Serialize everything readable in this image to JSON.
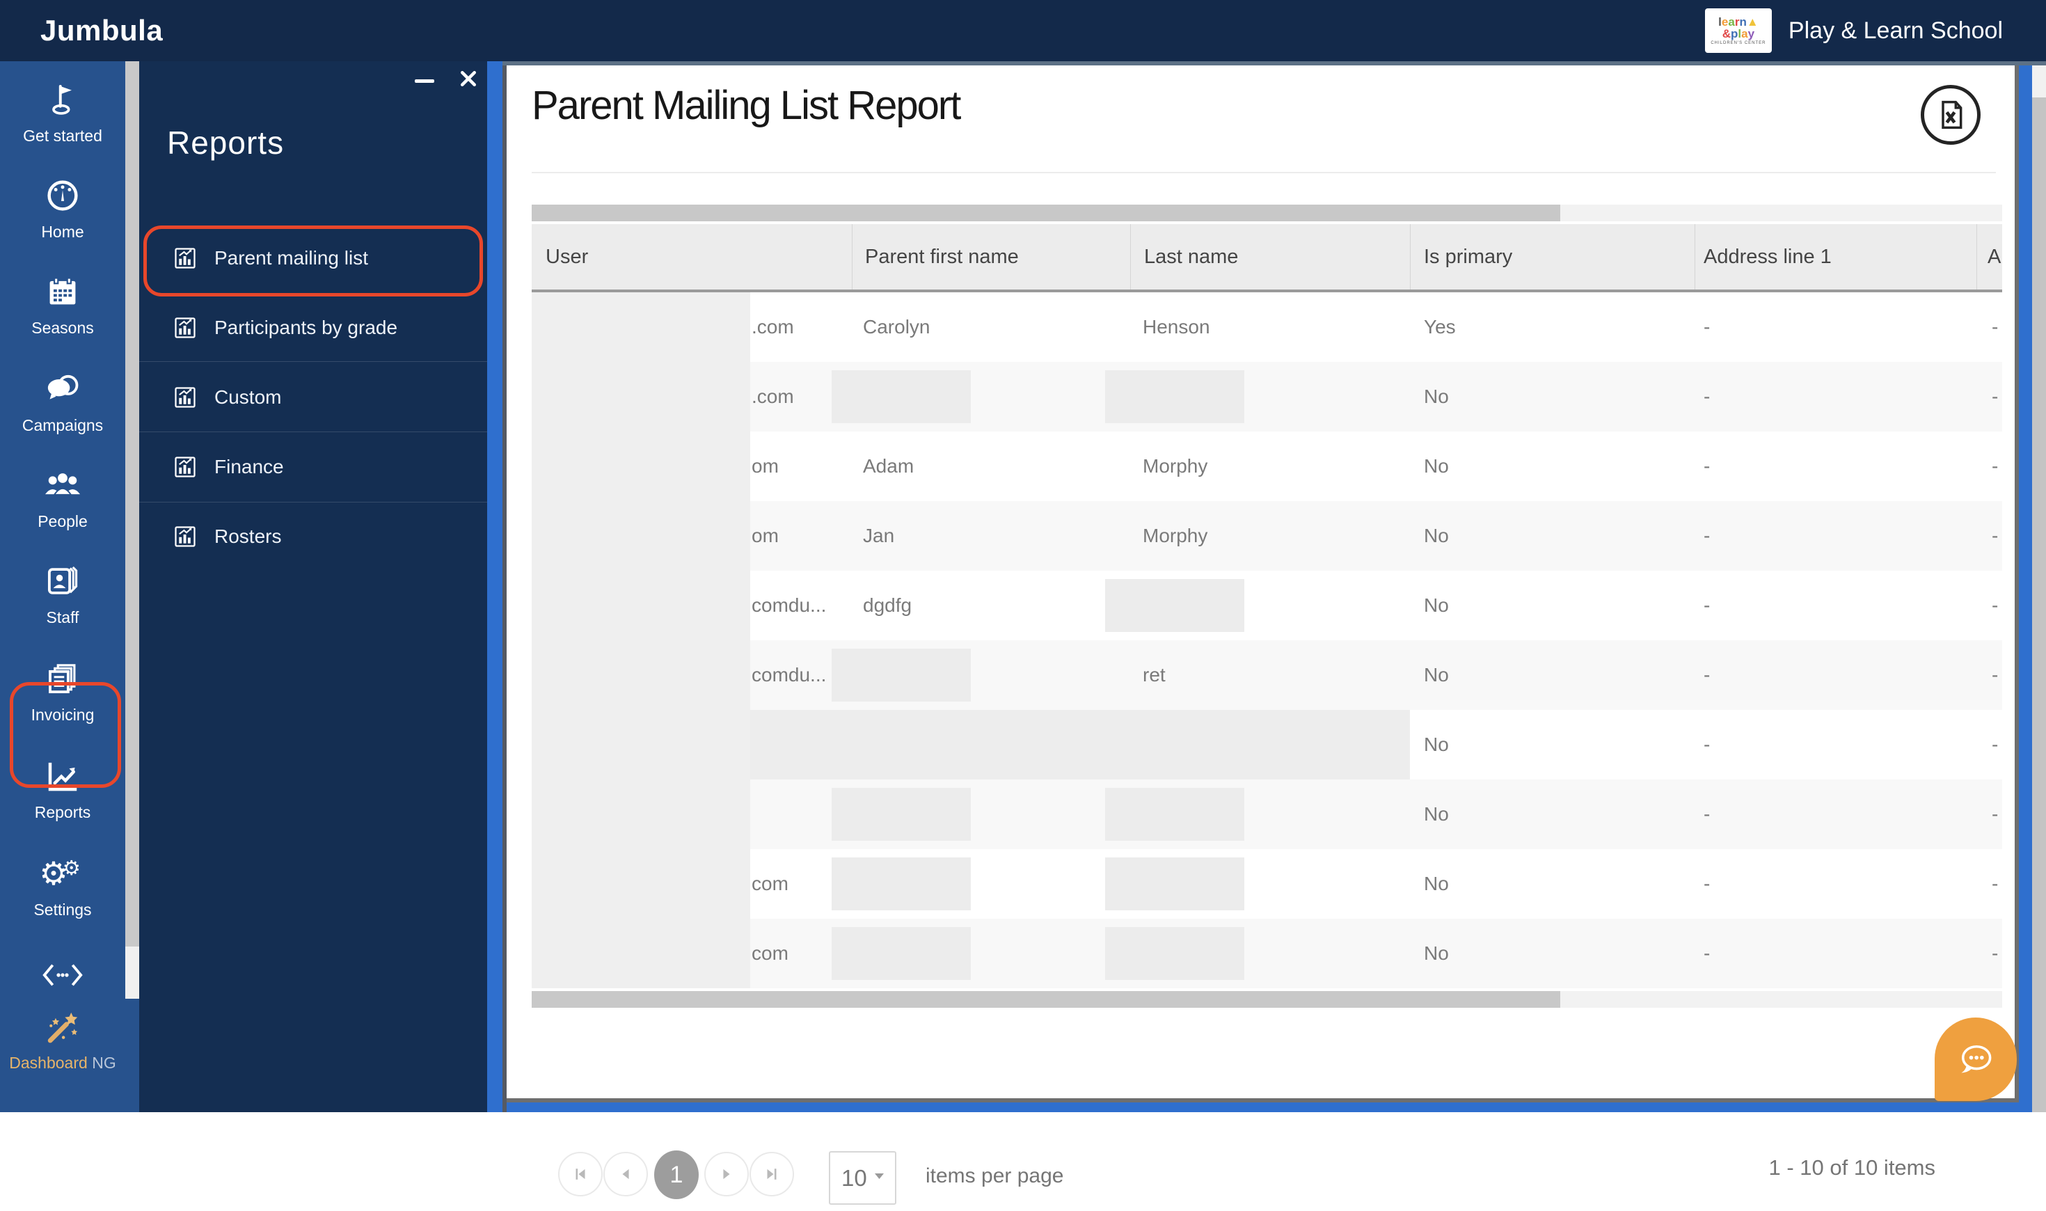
{
  "colors": {
    "topbar_bg": "#13294a",
    "sidebar_bg": "#27528d",
    "flyout_bg": "#142e52",
    "accent_red": "#e8472b",
    "scrollbar_blue": "#2f6fce",
    "chat_orange": "#efa03f",
    "gold": "#e7b469",
    "header_bg": "#ececec",
    "row_alt_bg": "#f8f8f8"
  },
  "topbar": {
    "brand": "Jumbula",
    "school_name": "Play & Learn School",
    "logo": {
      "line1": "learn",
      "line2": "&play",
      "line3": "CHILDREN'S CENTER"
    }
  },
  "sidebar": {
    "items": [
      {
        "id": "get-started",
        "label": "Get started",
        "icon": "flag-icon"
      },
      {
        "id": "home",
        "label": "Home",
        "icon": "gauge-icon"
      },
      {
        "id": "seasons",
        "label": "Seasons",
        "icon": "calendar-icon"
      },
      {
        "id": "campaigns",
        "label": "Campaigns",
        "icon": "chat-bubbles-icon"
      },
      {
        "id": "people",
        "label": "People",
        "icon": "people-icon"
      },
      {
        "id": "staff",
        "label": "Staff",
        "icon": "staff-card-icon"
      },
      {
        "id": "invoicing",
        "label": "Invoicing",
        "icon": "documents-icon"
      },
      {
        "id": "reports",
        "label": "Reports",
        "icon": "line-chart-icon",
        "highlighted": true
      },
      {
        "id": "settings",
        "label": "Settings",
        "icon": "gears-icon"
      },
      {
        "id": "dev-tools",
        "label": "",
        "icon": "code-icon"
      },
      {
        "id": "dashboard-ng",
        "label": "Dashboard",
        "label2": " NG",
        "icon": "magic-wand-icon"
      }
    ]
  },
  "flyout": {
    "title": "Reports",
    "items": [
      {
        "label": "Parent mailing list",
        "icon": "bar-chart-icon",
        "highlighted": true
      },
      {
        "label": "Participants by grade",
        "icon": "bar-chart-icon"
      },
      {
        "label": "Custom",
        "icon": "bar-chart-icon"
      },
      {
        "label": "Finance",
        "icon": "bar-chart-icon"
      },
      {
        "label": "Rosters",
        "icon": "bar-chart-icon"
      }
    ],
    "window_controls": [
      "minimize-icon",
      "close-icon"
    ]
  },
  "main": {
    "title": "Parent Mailing List Report",
    "export_icon": "excel-export-icon"
  },
  "table": {
    "columns": [
      "User",
      "Parent first name",
      "Last name",
      "Is primary",
      "Address line 1",
      "A"
    ],
    "rows": [
      {
        "user": ".com",
        "first": "Carolyn",
        "first_redacted": false,
        "last": "Henson",
        "last_redacted": false,
        "primary": "Yes",
        "addr1": "-",
        "addr2": "-",
        "band": false
      },
      {
        "user": ".com",
        "first": "",
        "first_redacted": true,
        "last": "",
        "last_redacted": true,
        "primary": "No",
        "addr1": "-",
        "addr2": "-",
        "band": false
      },
      {
        "user": "om",
        "first": "Adam",
        "first_redacted": false,
        "last": "Morphy",
        "last_redacted": false,
        "primary": "No",
        "addr1": "-",
        "addr2": "-",
        "band": false
      },
      {
        "user": "om",
        "first": "Jan",
        "first_redacted": false,
        "last": "Morphy",
        "last_redacted": false,
        "primary": "No",
        "addr1": "-",
        "addr2": "-",
        "band": false
      },
      {
        "user": "comdu...",
        "first": "dgdfg",
        "first_redacted": false,
        "last": "",
        "last_redacted": true,
        "primary": "No",
        "addr1": "-",
        "addr2": "-",
        "band": false
      },
      {
        "user": "comdu...",
        "first": "",
        "first_redacted": true,
        "last": "ret",
        "last_redacted": false,
        "primary": "No",
        "addr1": "-",
        "addr2": "-",
        "band": false
      },
      {
        "user": "",
        "first": "",
        "first_redacted": false,
        "last": "",
        "last_redacted": false,
        "primary": "No",
        "addr1": "-",
        "addr2": "-",
        "band": true
      },
      {
        "user": "",
        "first": "",
        "first_redacted": true,
        "last": "",
        "last_redacted": true,
        "primary": "No",
        "addr1": "-",
        "addr2": "-",
        "band": false
      },
      {
        "user": "com",
        "first": "",
        "first_redacted": true,
        "last": "",
        "last_redacted": true,
        "primary": "No",
        "addr1": "-",
        "addr2": "-",
        "band": false
      },
      {
        "user": "com",
        "first": "",
        "first_redacted": true,
        "last": "",
        "last_redacted": true,
        "primary": "No",
        "addr1": "-",
        "addr2": "-",
        "band": false
      }
    ]
  },
  "pager": {
    "current_page": "1",
    "page_size": "10",
    "items_per_page_label": "items per page",
    "range_label": "1 - 10 of 10 items",
    "buttons": [
      "seek-first-icon",
      "prev-page-icon",
      "next-page-icon",
      "seek-last-icon"
    ]
  }
}
